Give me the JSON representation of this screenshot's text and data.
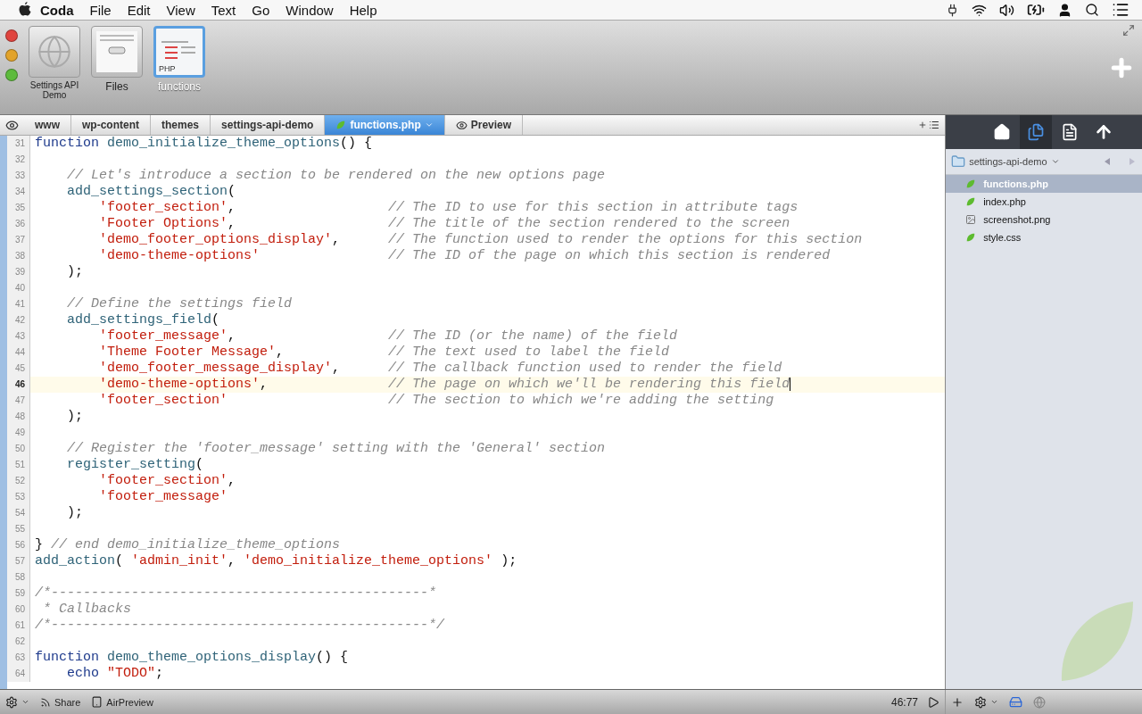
{
  "menubar": {
    "app": "Coda",
    "menus": [
      "File",
      "Edit",
      "View",
      "Text",
      "Go",
      "Window",
      "Help"
    ]
  },
  "sites": [
    {
      "label": "Settings API Demo",
      "kind": "site",
      "selected": false
    },
    {
      "label": "Files",
      "kind": "files",
      "selected": false
    },
    {
      "label": "functions",
      "kind": "php",
      "badge": "PHP",
      "selected": true
    }
  ],
  "path_bar": {
    "crumbs": [
      {
        "label": "www",
        "selected": false
      },
      {
        "label": "wp-content",
        "selected": false
      },
      {
        "label": "themes",
        "selected": false
      },
      {
        "label": "settings-api-demo",
        "selected": false
      },
      {
        "label": "functions.php",
        "selected": true
      }
    ],
    "preview": "Preview"
  },
  "editor": {
    "lines": [
      {
        "n": "31",
        "current": false,
        "code": [
          {
            "kind": "keyword",
            "t": "function"
          },
          {
            "kind": "name",
            "t": " demo_initialize_theme_options"
          },
          {
            "kind": "plain",
            "t": "() {"
          }
        ]
      },
      {
        "n": "32",
        "current": false
      },
      {
        "n": "33",
        "current": false,
        "code": [
          {
            "kind": "comment",
            "t": "    // Let's introduce a section to be rendered on the new options page"
          }
        ]
      },
      {
        "n": "34",
        "current": false,
        "code": [
          {
            "kind": "name",
            "t": "    add_settings_section"
          },
          {
            "kind": "plain",
            "t": "("
          }
        ]
      },
      {
        "n": "35",
        "current": false,
        "code": [
          {
            "kind": "string",
            "t": "        'footer_section'"
          },
          {
            "kind": "plain",
            "t": ","
          }
        ],
        "comment": "// The ID to use for this section in attribute tags"
      },
      {
        "n": "36",
        "current": false,
        "code": [
          {
            "kind": "string",
            "t": "        'Footer Options'"
          },
          {
            "kind": "plain",
            "t": ","
          }
        ],
        "comment": "// The title of the section rendered to the screen"
      },
      {
        "n": "37",
        "current": false,
        "code": [
          {
            "kind": "string",
            "t": "        'demo_footer_options_display'"
          },
          {
            "kind": "plain",
            "t": ","
          }
        ],
        "comment": "// The function used to render the options for this section"
      },
      {
        "n": "38",
        "current": false,
        "code": [
          {
            "kind": "string",
            "t": "        'demo-theme-options'"
          }
        ],
        "comment": "// The ID of the page on which this section is rendered"
      },
      {
        "n": "39",
        "current": false,
        "code": [
          {
            "kind": "plain",
            "t": "    );"
          }
        ]
      },
      {
        "n": "40",
        "current": false
      },
      {
        "n": "41",
        "current": false,
        "code": [
          {
            "kind": "comment",
            "t": "    // Define the settings field"
          }
        ]
      },
      {
        "n": "42",
        "current": false,
        "code": [
          {
            "kind": "name",
            "t": "    add_settings_field"
          },
          {
            "kind": "plain",
            "t": "("
          }
        ]
      },
      {
        "n": "43",
        "current": false,
        "code": [
          {
            "kind": "string",
            "t": "        'footer_message'"
          },
          {
            "kind": "plain",
            "t": ","
          }
        ],
        "comment": "// The ID (or the name) of the field"
      },
      {
        "n": "44",
        "current": false,
        "code": [
          {
            "kind": "string",
            "t": "        'Theme Footer Message'"
          },
          {
            "kind": "plain",
            "t": ","
          }
        ],
        "comment": "// The text used to label the field"
      },
      {
        "n": "45",
        "current": false,
        "code": [
          {
            "kind": "string",
            "t": "        'demo_footer_message_display'"
          },
          {
            "kind": "plain",
            "t": ","
          }
        ],
        "comment": "// The callback function used to render the field"
      },
      {
        "n": "46",
        "current": true,
        "code": [
          {
            "kind": "string",
            "t": "        'demo-theme-options'"
          },
          {
            "kind": "plain",
            "t": ","
          }
        ],
        "comment": "// The page on which we'll be rendering this field"
      },
      {
        "n": "47",
        "current": false,
        "code": [
          {
            "kind": "string",
            "t": "        'footer_section'"
          }
        ],
        "comment": "// The section to which we're adding the setting"
      },
      {
        "n": "48",
        "current": false,
        "code": [
          {
            "kind": "plain",
            "t": "    );"
          }
        ]
      },
      {
        "n": "49",
        "current": false
      },
      {
        "n": "50",
        "current": false,
        "code": [
          {
            "kind": "comment",
            "t": "    // Register the 'footer_message' setting with the 'General' section"
          }
        ]
      },
      {
        "n": "51",
        "current": false,
        "code": [
          {
            "kind": "name",
            "t": "    register_setting"
          },
          {
            "kind": "plain",
            "t": "("
          }
        ]
      },
      {
        "n": "52",
        "current": false,
        "code": [
          {
            "kind": "string",
            "t": "        'footer_section'"
          },
          {
            "kind": "plain",
            "t": ","
          }
        ]
      },
      {
        "n": "53",
        "current": false,
        "code": [
          {
            "kind": "string",
            "t": "        'footer_message'"
          }
        ]
      },
      {
        "n": "54",
        "current": false,
        "code": [
          {
            "kind": "plain",
            "t": "    );"
          }
        ]
      },
      {
        "n": "55",
        "current": false
      },
      {
        "n": "56",
        "current": false,
        "code": [
          {
            "kind": "plain",
            "t": "}"
          },
          {
            "kind": "comment",
            "t": " // end demo_initialize_theme_options"
          }
        ]
      },
      {
        "n": "57",
        "current": false,
        "code": [
          {
            "kind": "name",
            "t": "add_action"
          },
          {
            "kind": "plain",
            "t": "( "
          },
          {
            "kind": "string",
            "t": "'admin_init'"
          },
          {
            "kind": "plain",
            "t": ", "
          },
          {
            "kind": "string",
            "t": "'demo_initialize_theme_options'"
          },
          {
            "kind": "plain",
            "t": " );"
          }
        ]
      },
      {
        "n": "58",
        "current": false
      },
      {
        "n": "59",
        "current": false,
        "code": [
          {
            "kind": "comment",
            "t": "/*-----------------------------------------------*"
          }
        ]
      },
      {
        "n": "60",
        "current": false,
        "code": [
          {
            "kind": "comment",
            "t": " * Callbacks"
          }
        ]
      },
      {
        "n": "61",
        "current": false,
        "code": [
          {
            "kind": "comment",
            "t": "/*-----------------------------------------------*/"
          }
        ]
      },
      {
        "n": "62",
        "current": false
      },
      {
        "n": "63",
        "current": false,
        "code": [
          {
            "kind": "keyword",
            "t": "function"
          },
          {
            "kind": "name",
            "t": " demo_theme_options_display"
          },
          {
            "kind": "plain",
            "t": "() {"
          }
        ]
      },
      {
        "n": "64",
        "current": false,
        "code": [
          {
            "kind": "keyword",
            "t": "    echo"
          },
          {
            "kind": "string",
            "t": " \"TODO\""
          },
          {
            "kind": "plain",
            "t": ";"
          }
        ]
      }
    ]
  },
  "sidebar": {
    "folder": "settings-api-demo",
    "files": [
      {
        "name": "functions.php",
        "kind": "leaf",
        "selected": true
      },
      {
        "name": "index.php",
        "kind": "leaf",
        "selected": false
      },
      {
        "name": "screenshot.png",
        "kind": "image",
        "selected": false
      },
      {
        "name": "style.css",
        "kind": "leaf",
        "selected": false
      }
    ]
  },
  "status_bar": {
    "share": "Share",
    "airpreview": "AirPreview",
    "position": "46:77"
  }
}
